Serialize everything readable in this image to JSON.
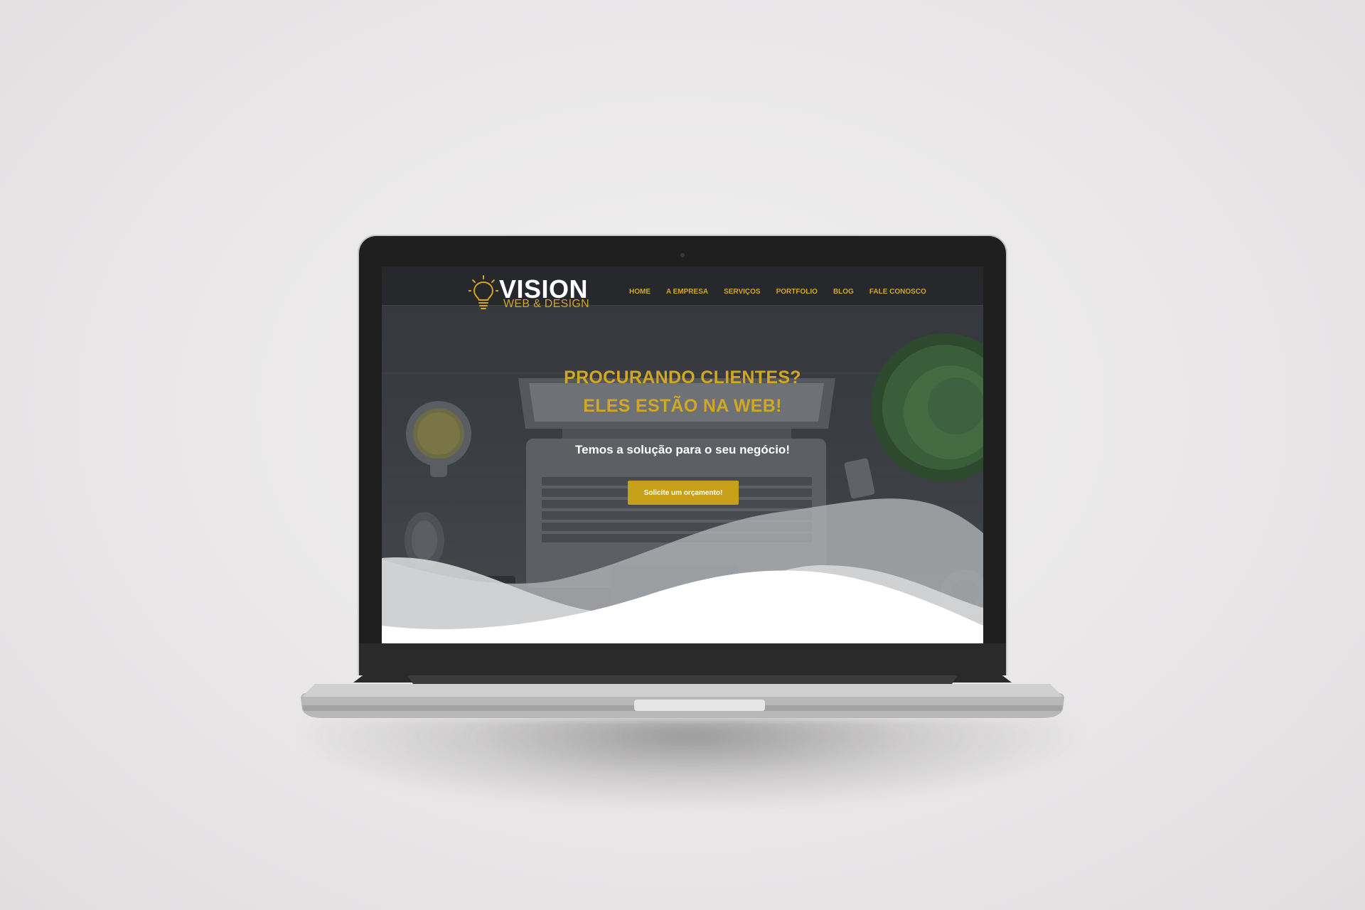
{
  "site": {
    "logo": {
      "name": "VISION",
      "subtitle": "WEB & DESIGN"
    },
    "nav": [
      {
        "label": "HOME"
      },
      {
        "label": "A EMPRESA"
      },
      {
        "label": "SERVIÇOS"
      },
      {
        "label": "PORTFOLIO"
      },
      {
        "label": "BLOG"
      },
      {
        "label": "FALE CONOSCO"
      }
    ],
    "hero": {
      "headline_line1": "PROCURANDO CLIENTES?",
      "headline_line2": "ELES ESTÃO NA WEB!",
      "tagline": "Temos a solução para o seu negócio!",
      "cta_label": "Solicite um orçamento!"
    }
  },
  "colors": {
    "accent": "#d2a722",
    "button": "#c7a01a",
    "background": "#ebe9ea"
  }
}
